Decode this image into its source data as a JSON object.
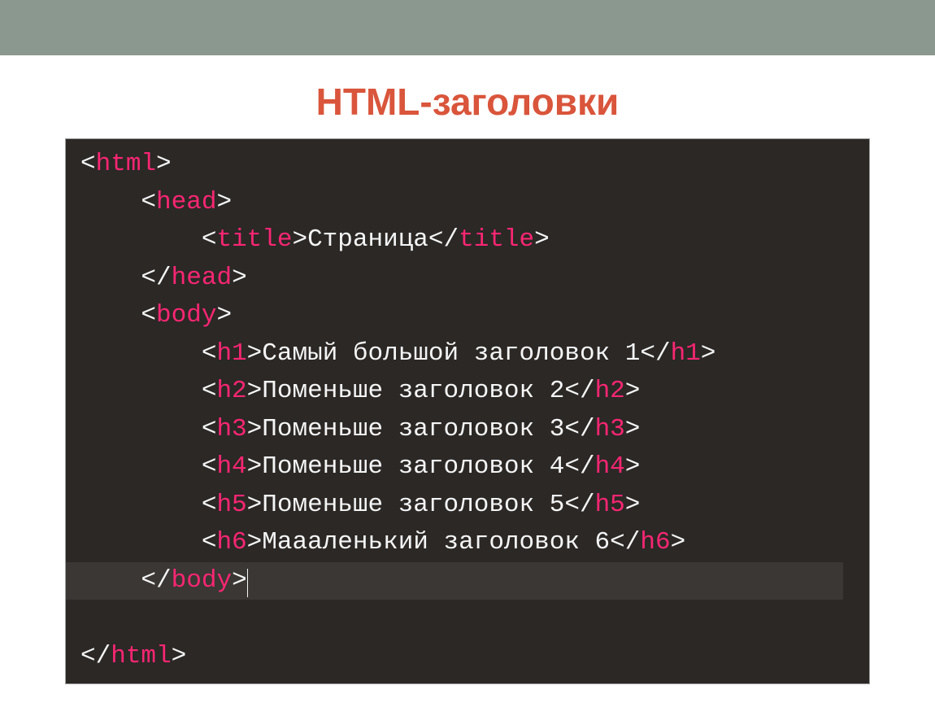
{
  "heading": "HTML-заголовки",
  "code": {
    "tags": {
      "html": "html",
      "head": "head",
      "title": "title",
      "body": "body",
      "h1": "h1",
      "h2": "h2",
      "h3": "h3",
      "h4": "h4",
      "h5": "h5",
      "h6": "h6"
    },
    "title_text": "Страница",
    "h1_text": "Самый большой заголовок 1",
    "h2_text": "Поменьше заголовок 2",
    "h3_text": "Поменьше заголовок 3",
    "h4_text": "Поменьше заголовок 4",
    "h5_text": "Поменьше заголовок 5",
    "h6_text": "Маааленький заголовок 6"
  },
  "colors": {
    "top_bar": "#8a988f",
    "heading": "#d9553b",
    "editor_bg": "#2b2826",
    "tag_name": "#f92672",
    "text": "#f5f5f5"
  }
}
